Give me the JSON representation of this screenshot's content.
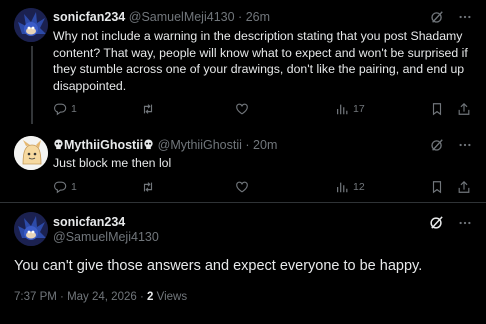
{
  "reply1": {
    "display_name": "sonicfan234",
    "handle": "@SamuelMeji4130",
    "dot": "·",
    "time": "26m",
    "text": "Why not include a warning in the description stating that you post Shadamy content? That way, people will know what to expect and won't be surprised if they stumble across one of your drawings, don't like the pairing, and end up disappointed.",
    "replies": "1",
    "views": "17"
  },
  "reply2": {
    "display_name": "MythiiGhostii",
    "handle": "@MythiiGhostii",
    "dot": "·",
    "time": "20m",
    "text": "Just block me then lol",
    "replies": "1",
    "views": "12"
  },
  "main_post": {
    "display_name": "sonicfan234",
    "handle": "@SamuelMeji4130",
    "text": "You can't give those answers and expect everyone to be happy.",
    "time": "7:37 PM",
    "dot1": "·",
    "date": "May 24, 2026",
    "dot2": "·",
    "views_count": "2",
    "views_label": "Views"
  },
  "icons": {
    "grok": "grok-icon",
    "more": "more-icon",
    "reply": "reply-icon",
    "repost": "repost-icon",
    "like": "like-icon",
    "views": "views-icon",
    "bookmark": "bookmark-icon",
    "share": "share-icon"
  },
  "colors": {
    "background": "#000000",
    "text": "#e7e9ea",
    "muted": "#71767b",
    "divider": "#2f3336"
  }
}
